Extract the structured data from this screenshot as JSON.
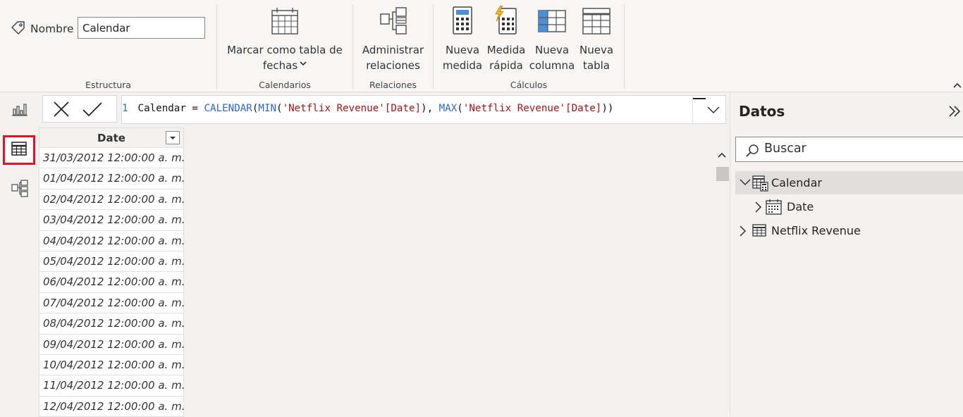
{
  "ribbon": {
    "estructura": {
      "name_label": "Nombre",
      "name_value": "Calendar",
      "group_label": "Estructura"
    },
    "calendarios": {
      "button_line1": "Marcar como tabla de",
      "button_line2": "fechas",
      "group_label": "Calendarios"
    },
    "relaciones": {
      "button_line1": "Administrar",
      "button_line2": "relaciones",
      "group_label": "Relaciones"
    },
    "calculos": {
      "group_label": "Cálculos",
      "buttons": [
        {
          "line1": "Nueva",
          "line2": "medida",
          "icon": "calculator-icon"
        },
        {
          "line1": "Medida",
          "line2": "rápida",
          "icon": "quick-measure-icon"
        },
        {
          "line1": "Nueva",
          "line2": "columna",
          "icon": "new-column-icon"
        },
        {
          "line1": "Nueva",
          "line2": "tabla",
          "icon": "new-table-icon"
        }
      ]
    }
  },
  "formula": {
    "line_number": "1",
    "name": "Calendar",
    "op": " = ",
    "fn1": "CALENDAR",
    "p1": "(",
    "fn2": "MIN",
    "p2": "(",
    "arg1": "'Netflix Revenue'[Date]",
    "p3": "), ",
    "fn3": "MAX",
    "p4": "(",
    "arg2": "'Netflix Revenue'[Date]",
    "p5": "))"
  },
  "grid": {
    "header": "Date",
    "rows": [
      "31/03/2012 12:00:00 a. m.",
      "01/04/2012 12:00:00 a. m.",
      "02/04/2012 12:00:00 a. m.",
      "03/04/2012 12:00:00 a. m.",
      "04/04/2012 12:00:00 a. m.",
      "05/04/2012 12:00:00 a. m.",
      "06/04/2012 12:00:00 a. m.",
      "07/04/2012 12:00:00 a. m.",
      "08/04/2012 12:00:00 a. m.",
      "09/04/2012 12:00:00 a. m.",
      "10/04/2012 12:00:00 a. m.",
      "11/04/2012 12:00:00 a. m.",
      "12/04/2012 12:00:00 a. m."
    ]
  },
  "data_pane": {
    "title": "Datos",
    "search_placeholder": "Buscar",
    "tree": [
      {
        "label": "Calendar",
        "icon": "calculated-table-icon",
        "expanded": true
      },
      {
        "label": "Date",
        "icon": "date-hierarchy-icon",
        "expanded": false
      },
      {
        "label": "Netflix Revenue",
        "icon": "table-icon",
        "expanded": false
      }
    ]
  },
  "colors": {
    "active_nav_border": "#e81123",
    "dax_keyword": "#3165cc",
    "dax_string": "#a31515",
    "line_number": "#237893"
  }
}
